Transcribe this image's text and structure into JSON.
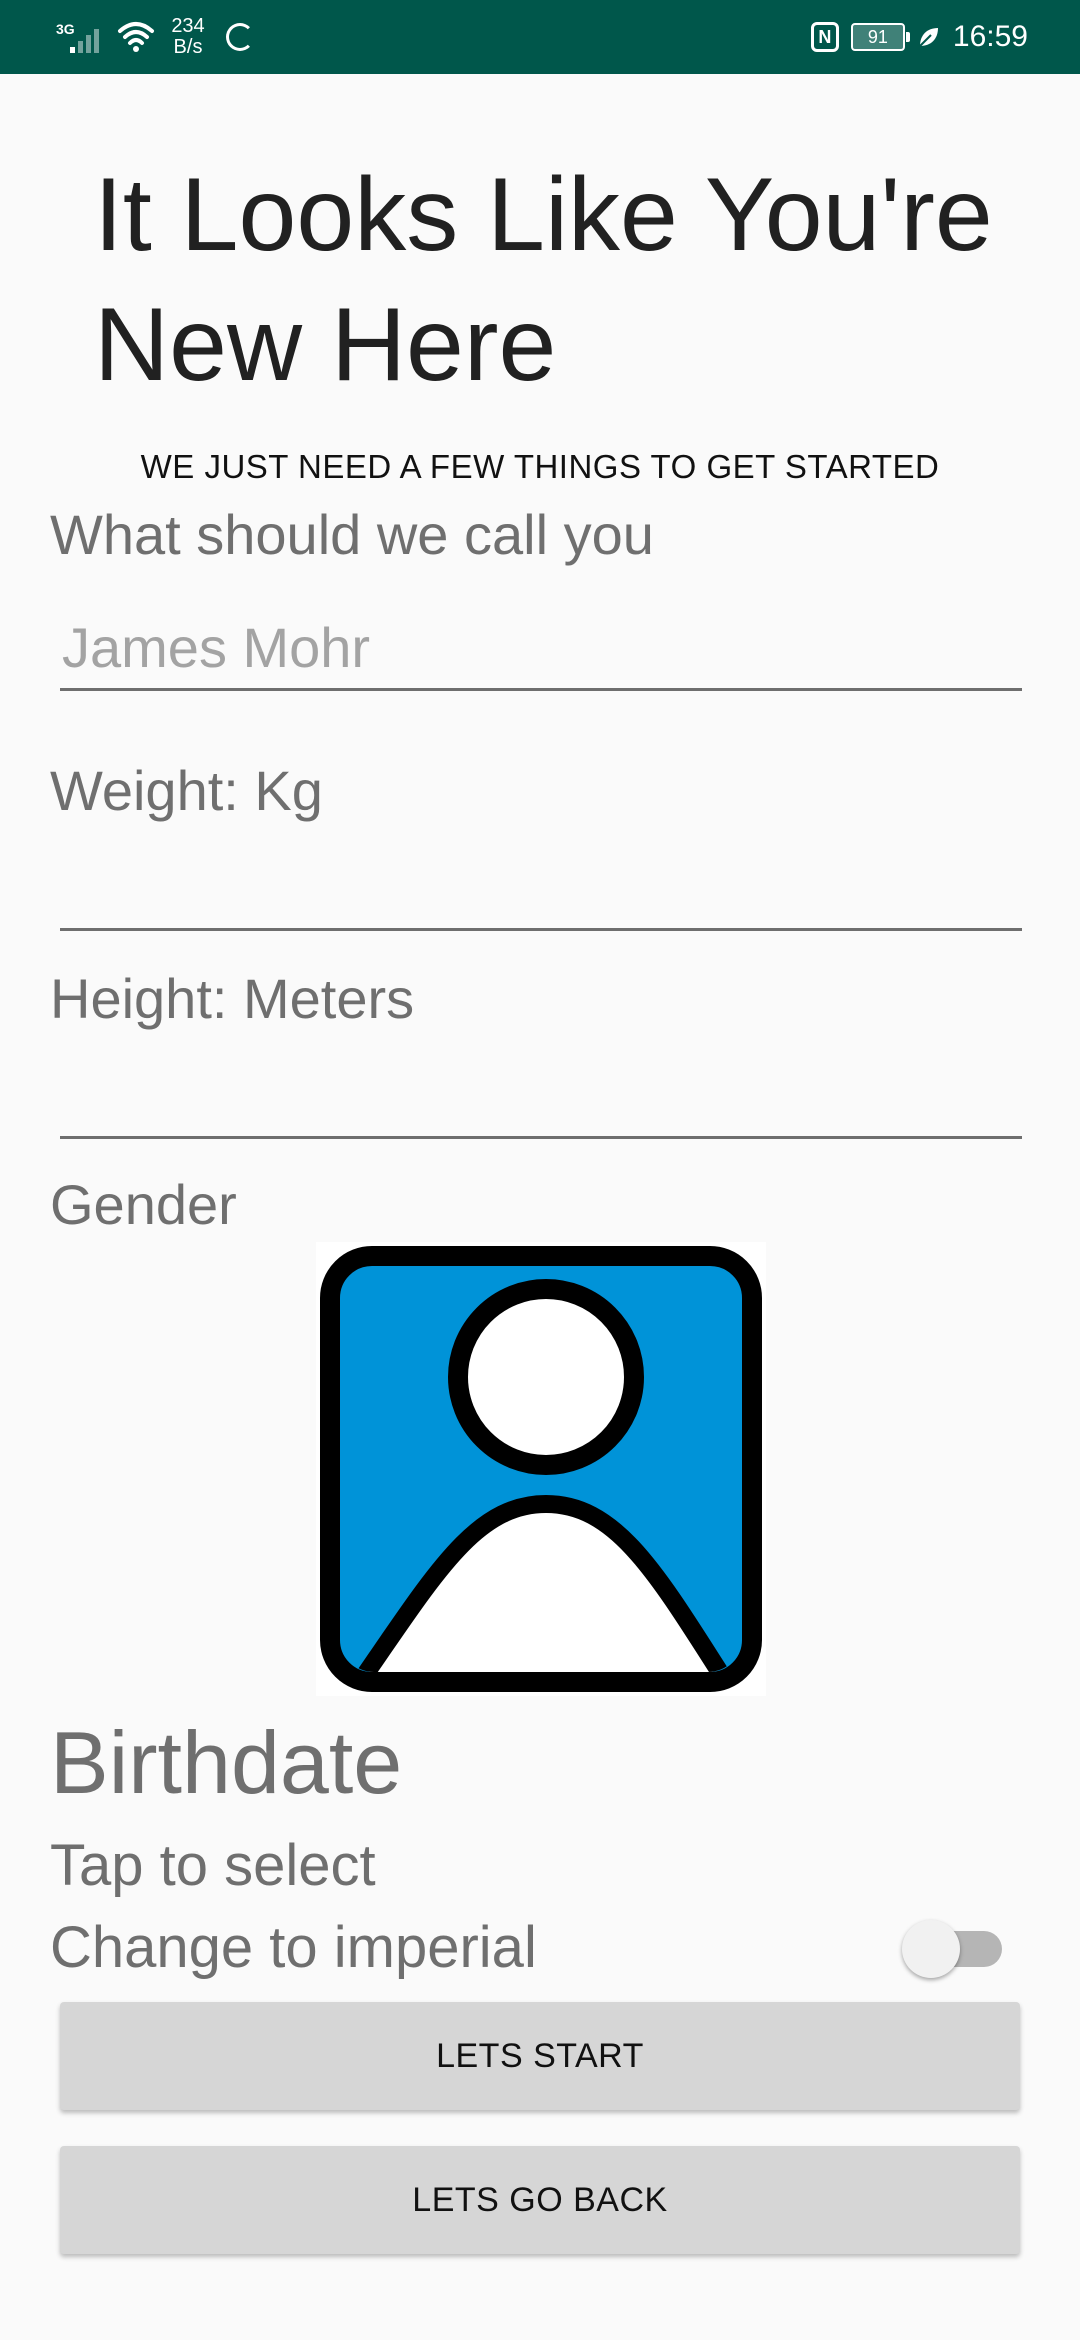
{
  "status_bar": {
    "network_type": "3G",
    "net_speed_value": "234",
    "net_speed_unit": "B/s",
    "nfc_label": "N",
    "battery_level": "91",
    "time": "16:59",
    "background_color": "#00574b"
  },
  "page": {
    "title": "It Looks Like You're New Here",
    "subtitle": "WE JUST NEED A FEW THINGS TO GET STARTED"
  },
  "form": {
    "name_label": "What should we call you",
    "name_placeholder": "James Mohr",
    "name_value": "",
    "weight_label": "Weight: Kg",
    "weight_value": "",
    "height_label": "Height: Meters",
    "height_value": "",
    "gender_label": "Gender",
    "gender_icon": "person-icon",
    "avatar_color": "#0093d8",
    "birthdate_label": "Birthdate",
    "birthdate_hint": "Tap to select",
    "imperial_label": "Change to imperial",
    "imperial_enabled": false
  },
  "actions": {
    "start_label": "LETS START",
    "back_label": "LETS GO BACK"
  }
}
